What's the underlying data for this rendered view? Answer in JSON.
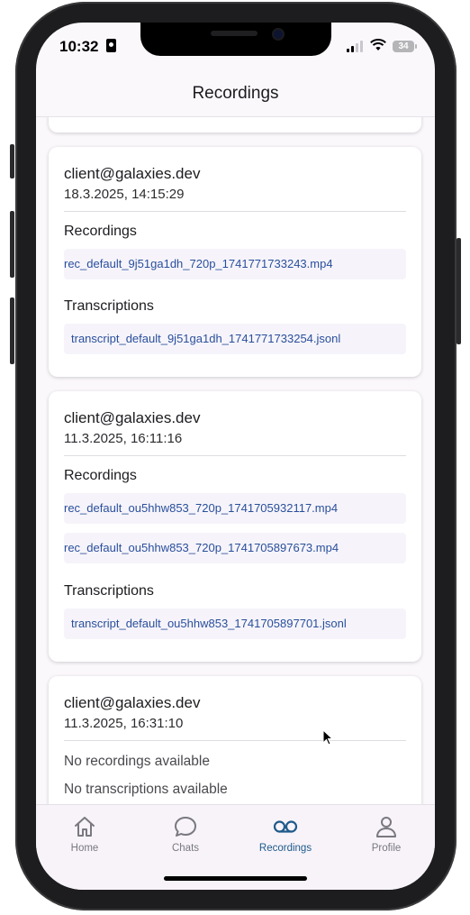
{
  "status": {
    "time": "10:32",
    "battery": "34"
  },
  "header": {
    "title": "Recordings"
  },
  "labels": {
    "recordings": "Recordings",
    "transcriptions": "Transcriptions",
    "no_recordings": "No recordings available",
    "no_transcriptions": "No transcriptions available"
  },
  "cards": [
    {
      "user": "client@galaxies.dev",
      "date": "18.3.2025, 14:15:29",
      "recordings": [
        "rec_default_9j51ga1dh_720p_1741771733243.mp4"
      ],
      "transcriptions": [
        "transcript_default_9j51ga1dh_1741771733254.jsonl"
      ]
    },
    {
      "user": "client@galaxies.dev",
      "date": "11.3.2025, 16:11:16",
      "recordings": [
        "rec_default_ou5hhw853_720p_1741705932117.mp4",
        "rec_default_ou5hhw853_720p_1741705897673.mp4"
      ],
      "transcriptions": [
        "transcript_default_ou5hhw853_1741705897701.jsonl"
      ]
    },
    {
      "user": "client@galaxies.dev",
      "date": "11.3.2025, 16:31:10",
      "recordings": [],
      "transcriptions": []
    }
  ],
  "tabs": [
    {
      "label": "Home",
      "icon": "home-icon",
      "active": false
    },
    {
      "label": "Chats",
      "icon": "chat-bubble-icon",
      "active": false
    },
    {
      "label": "Recordings",
      "icon": "voicemail-icon",
      "active": true
    },
    {
      "label": "Profile",
      "icon": "person-icon",
      "active": false
    }
  ],
  "colors": {
    "accent": "#1f5a8a",
    "link": "#2a4f9c",
    "inactive_tab": "#7a7880",
    "background": "#fbf8fc"
  }
}
